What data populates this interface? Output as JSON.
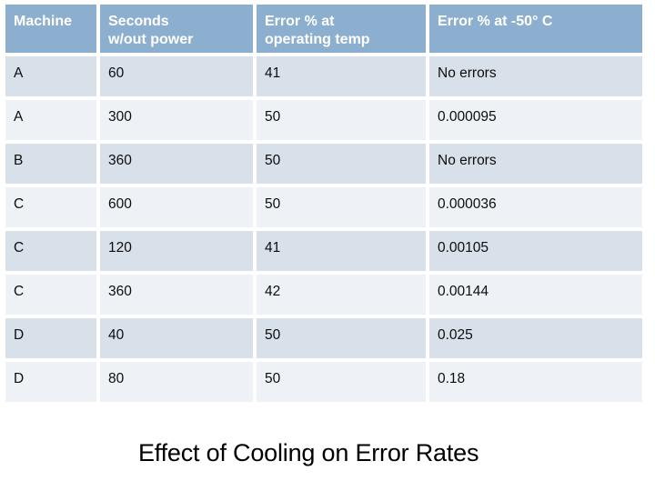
{
  "slide": {
    "title": "Effect of Cooling on Error Rates",
    "accent_header_color": "#8cafd0",
    "band_dark_color": "#d8e0ea",
    "band_light_color": "#eef1f6",
    "text_color": "#0d0d0d",
    "header_text_color": "#ffffff",
    "background_color": "#ffffff"
  },
  "table": {
    "headers": [
      "Machine",
      "Seconds\nw/out power",
      "Error % at\noperating temp",
      "Error % at -50° C"
    ],
    "rows": [
      {
        "machine": "A",
        "seconds_wout_power": "60",
        "error_pct_operating_temp": "41",
        "error_pct_minus50c": "No errors"
      },
      {
        "machine": "A",
        "seconds_wout_power": "300",
        "error_pct_operating_temp": "50",
        "error_pct_minus50c": "0.000095"
      },
      {
        "machine": "B",
        "seconds_wout_power": "360",
        "error_pct_operating_temp": "50",
        "error_pct_minus50c": "No errors"
      },
      {
        "machine": "C",
        "seconds_wout_power": "600",
        "error_pct_operating_temp": "50",
        "error_pct_minus50c": "0.000036"
      },
      {
        "machine": "C",
        "seconds_wout_power": "120",
        "error_pct_operating_temp": "41",
        "error_pct_minus50c": "0.00105"
      },
      {
        "machine": "C",
        "seconds_wout_power": "360",
        "error_pct_operating_temp": "42",
        "error_pct_minus50c": "0.00144"
      },
      {
        "machine": "D",
        "seconds_wout_power": "40",
        "error_pct_operating_temp": "50",
        "error_pct_minus50c": "0.025"
      },
      {
        "machine": "D",
        "seconds_wout_power": "80",
        "error_pct_operating_temp": "50",
        "error_pct_minus50c": "0.18"
      }
    ]
  }
}
